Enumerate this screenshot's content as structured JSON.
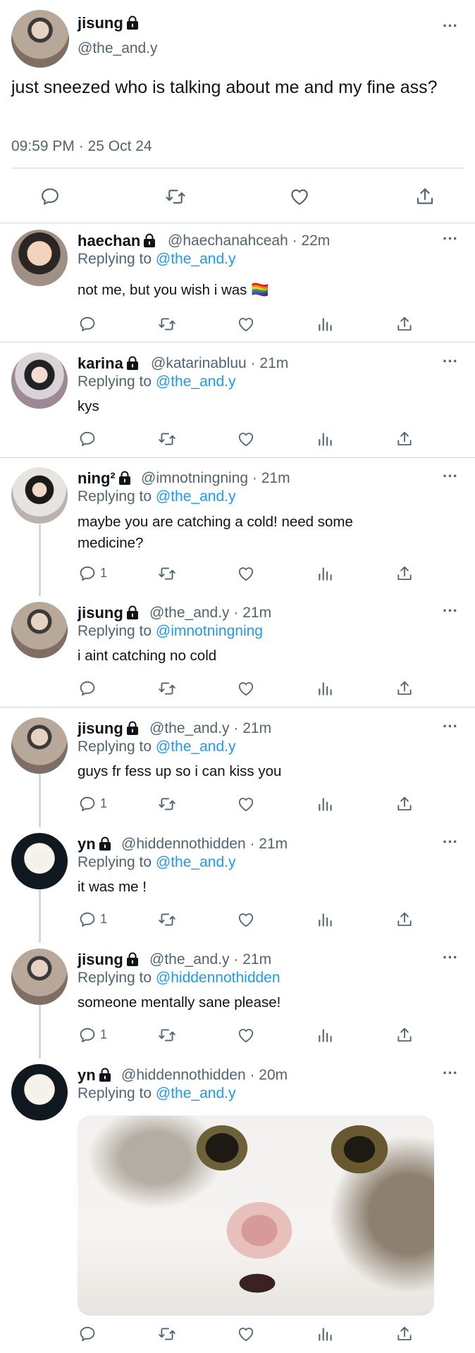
{
  "main_tweet": {
    "name": "jisung",
    "handle": "@the_and.y",
    "text": "just sneezed who is talking about me and my fine ass?",
    "timestamp": "09:59 PM · 25 Oct 24"
  },
  "replies": [
    {
      "name": "haechan",
      "handle": "@haechanahceah · 22m",
      "replying_prefix": "Replying to",
      "replying_to": "@the_and.y",
      "text": "not me, but you wish i was 🏳️‍🌈",
      "reply_count": ""
    },
    {
      "name": "karina",
      "handle": "@katarinabluu · 21m",
      "replying_prefix": "Replying to",
      "replying_to": "@the_and.y",
      "text": "kys",
      "reply_count": ""
    },
    {
      "name": "ning²",
      "handle": "@imnotningning · 21m",
      "replying_prefix": "Replying to",
      "replying_to": "@the_and.y",
      "text": "maybe you are catching a cold! need some medicine?",
      "reply_count": "1"
    },
    {
      "name": "jisung",
      "handle": "@the_and.y · 21m",
      "replying_prefix": "Replying to",
      "replying_to": "@imnotningning",
      "text": "i aint catching no cold",
      "reply_count": ""
    },
    {
      "name": "jisung",
      "handle": "@the_and.y · 21m",
      "replying_prefix": "Replying to",
      "replying_to": "@the_and.y",
      "text": "guys fr fess up so i can kiss you",
      "reply_count": "1"
    },
    {
      "name": "yn",
      "handle": "@hiddennothidden · 21m",
      "replying_prefix": "Replying to",
      "replying_to": "@the_and.y",
      "text": "it was me !",
      "reply_count": "1"
    },
    {
      "name": "jisung",
      "handle": "@the_and.y · 21m",
      "replying_prefix": "Replying to",
      "replying_to": "@hiddennothidden",
      "text": "someone mentally sane please!",
      "reply_count": "1"
    },
    {
      "name": "yn",
      "handle": "@hiddennothidden · 20m",
      "replying_prefix": "Replying to",
      "replying_to": "@the_and.y",
      "text": "",
      "reply_count": ""
    }
  ],
  "more_label": "···",
  "icons": [
    "reply-icon",
    "retweet-icon",
    "like-icon",
    "views-icon",
    "share-icon",
    "lock-icon",
    "more-icon"
  ],
  "colors": {
    "link": "#1d9bf0",
    "secondary": "#536471",
    "divider": "#cfd9de"
  }
}
